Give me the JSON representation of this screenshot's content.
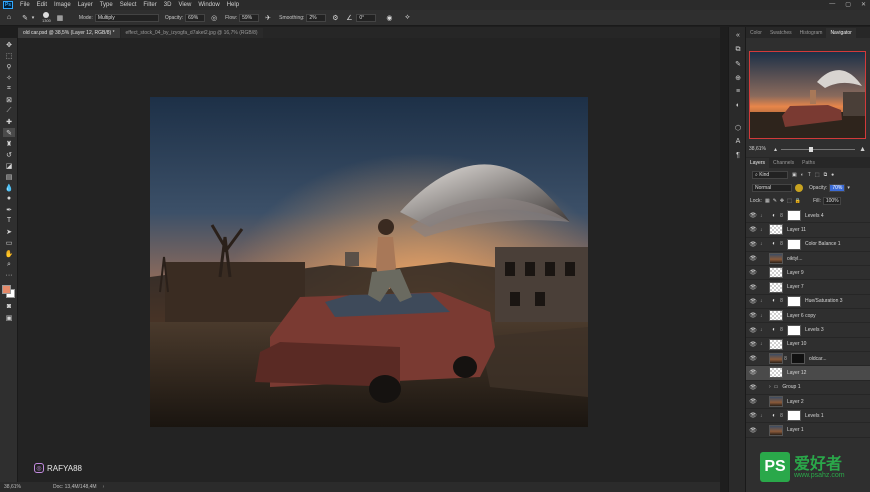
{
  "menubar": {
    "app_icon": "Ps",
    "items": [
      "File",
      "Edit",
      "Image",
      "Layer",
      "Type",
      "Select",
      "Filter",
      "3D",
      "View",
      "Window",
      "Help"
    ]
  },
  "options_bar": {
    "brush_size": "1300",
    "mode_label": "Mode:",
    "mode_value": "Multiply",
    "opacity_label": "Opacity:",
    "opacity_value": "69%",
    "flow_label": "Flow:",
    "flow_value": "59%",
    "smoothing_label": "Smoothing:",
    "smoothing_value": "2%",
    "angle_value": "0°"
  },
  "document_tabs": [
    {
      "label": "old car.psd @ 38,5% (Layer 12, RGB/8) *",
      "active": true
    },
    {
      "label": "effect_stock_04_by_izyogfa_d7aket2.jpg @ 16,7% (RGB/8)",
      "active": false
    }
  ],
  "status": {
    "zoom": "38,61%",
    "doc": "Doc: 13,4M/148,4M"
  },
  "watermark": {
    "handle": "RAFYA88"
  },
  "panel_tabs": [
    "Color",
    "Swatches",
    "Histogram",
    "Navigator"
  ],
  "navigator": {
    "zoom": "38,61%"
  },
  "layers_panel": {
    "tabs": [
      "Layers",
      "Channels",
      "Paths"
    ],
    "filter_label": "Kind",
    "blend_mode": "Normal",
    "opacity_label": "Opacity:",
    "opacity_value": "70%",
    "lock_label": "Lock:",
    "fill_label": "Fill:",
    "fill_value": "100%",
    "layers": [
      {
        "name": "Levels 4",
        "kind": "adjustment",
        "indent": true
      },
      {
        "name": "Layer 11",
        "kind": "pixel",
        "indent": true
      },
      {
        "name": "Color Balance 1",
        "kind": "adjustment",
        "indent": true
      },
      {
        "name": "oiktyl...",
        "kind": "image"
      },
      {
        "name": "Layer 9",
        "kind": "pixel"
      },
      {
        "name": "Layer 7",
        "kind": "pixel"
      },
      {
        "name": "Hue/Saturation 3",
        "kind": "adjustment",
        "indent": true
      },
      {
        "name": "Layer 6 copy",
        "kind": "pixel",
        "indent": true
      },
      {
        "name": "Levels 3",
        "kind": "adjustment",
        "indent": true
      },
      {
        "name": "Layer 10",
        "kind": "pixel",
        "indent": true
      },
      {
        "name": "oldcar...",
        "kind": "image"
      },
      {
        "name": "Layer 12",
        "kind": "pixel",
        "selected": true
      },
      {
        "name": "Group 1",
        "kind": "group"
      },
      {
        "name": "Layer 2",
        "kind": "image"
      },
      {
        "name": "Levels 1",
        "kind": "adjustment",
        "indent": true
      },
      {
        "name": "Layer 1",
        "kind": "image"
      }
    ]
  },
  "site_watermark": {
    "logo_text": "PS",
    "title": "爱好者",
    "url": "www.psahz.com"
  },
  "colors": {
    "foreground": "#e58a6a",
    "background": "#ffffff",
    "accent_selected": "#c9c9c9"
  }
}
